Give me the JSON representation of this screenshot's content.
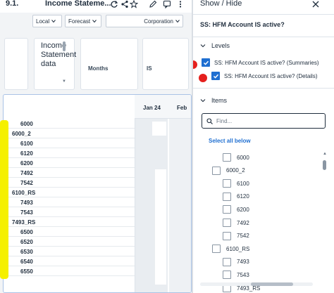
{
  "report": {
    "number": "9.1.",
    "title": "Income Stateme...",
    "pov": [
      {
        "label": "Local"
      },
      {
        "label": "Forecast"
      },
      {
        "label": "Corporation"
      }
    ],
    "header_cards": {
      "income_statement": "Income Statement data",
      "months": "Months",
      "is": "IS"
    },
    "columns": [
      "Jan 24",
      "Feb"
    ],
    "rows": [
      "6000",
      "6000_2",
      "6100",
      "6120",
      "6200",
      "7492",
      "7542",
      "6100_RS",
      "7493",
      "7543",
      "7493_RS",
      "6500",
      "6520",
      "6530",
      "6540",
      "6550"
    ]
  },
  "panel": {
    "title": "Show / Hide",
    "subtitle": "SS: HFM Account IS active?",
    "levels_label": "Levels",
    "levels": [
      {
        "label": "SS: HFM Account IS active? (Summaries)",
        "checked": true
      },
      {
        "label": "SS: HFM Account IS active? (Details)",
        "checked": true
      }
    ],
    "items_label": "Items",
    "find_placeholder": "Find...",
    "select_all": "Select all below",
    "items": [
      {
        "label": "6000",
        "indent": 1
      },
      {
        "label": "6000_2",
        "indent": 0
      },
      {
        "label": "6100",
        "indent": 1
      },
      {
        "label": "6120",
        "indent": 1
      },
      {
        "label": "6200",
        "indent": 1
      },
      {
        "label": "7492",
        "indent": 1
      },
      {
        "label": "7542",
        "indent": 1
      },
      {
        "label": "6100_RS",
        "indent": 0
      },
      {
        "label": "7493",
        "indent": 1
      },
      {
        "label": "7543",
        "indent": 1
      },
      {
        "label": "7493_RS",
        "indent": 1
      }
    ]
  },
  "colors": {
    "accent": "#1f6fd1",
    "annotation_dot": "#e5201d",
    "highlight": "#f5f000"
  }
}
